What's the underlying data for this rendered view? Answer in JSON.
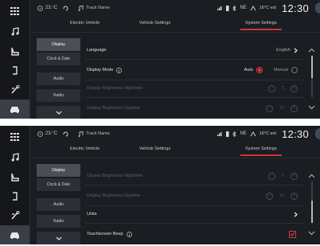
{
  "status": {
    "cabin_temp": "23.°C",
    "track_name": "Track Name",
    "outside_temp": "16°C ext",
    "time": "12:30",
    "signal_label": "NE"
  },
  "tabs": [
    "Electric Vehicle",
    "Vehicle Settings",
    "System Settings"
  ],
  "left_menu": [
    "Display",
    "Clock & Date",
    "Audio",
    "Radio"
  ],
  "top_screen": {
    "language_label": "Language",
    "language_value": "English",
    "display_mode_label": "Display Mode",
    "auto_label": "Auto",
    "manual_label": "Manual",
    "brightness_night_label": "Display Brightness Nighttime",
    "brightness_day_label": "Display Brightness Daytime",
    "night_value": "5",
    "day_value": "10",
    "display_mode_selected": "Auto"
  },
  "bottom_screen": {
    "brightness_night_label": "Display Brightness Nighttime",
    "brightness_day_label": "Display Brightness Daytime",
    "units_label": "Units",
    "beep_label": "Touchscreen Beep",
    "night_value": "5",
    "day_value": "10",
    "beep_checked": true
  },
  "colors": {
    "accent": "#d0343b",
    "background": "#1a1d22",
    "rail": "#15171b"
  }
}
